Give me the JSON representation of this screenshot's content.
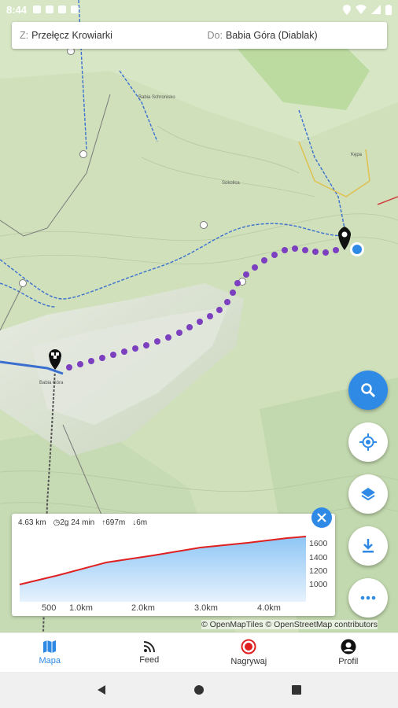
{
  "statusbar": {
    "time": "8:44"
  },
  "route": {
    "from_prefix": "Z:",
    "from_value": "Przełęcz Krowiarki",
    "to_prefix": "Do:",
    "to_value": "Babia Góra (Diablak)"
  },
  "map": {
    "labels": {
      "kepa": "Kępa",
      "babia_gora": "Babia Góra",
      "schronisko": "Babia Schronisko",
      "sokolica": "Sokolica"
    }
  },
  "elevation": {
    "distance": "4.63 km",
    "duration": "2g 24 min",
    "ascent": "697m",
    "descent": "6m",
    "y_labels": [
      "1600",
      "1400",
      "1200",
      "1000"
    ],
    "x_labels": [
      "500",
      "1.0km",
      "2.0km",
      "3.0km",
      "4.0km"
    ]
  },
  "attribution": "© OpenMapTiles © OpenStreetMap contributors",
  "nav": {
    "map": "Mapa",
    "feed": "Feed",
    "record": "Nagrywaj",
    "profile": "Profil"
  },
  "colors": {
    "accent": "#2f8ae6",
    "route": "#7b3fbf",
    "profile_line": "#e02020"
  }
}
